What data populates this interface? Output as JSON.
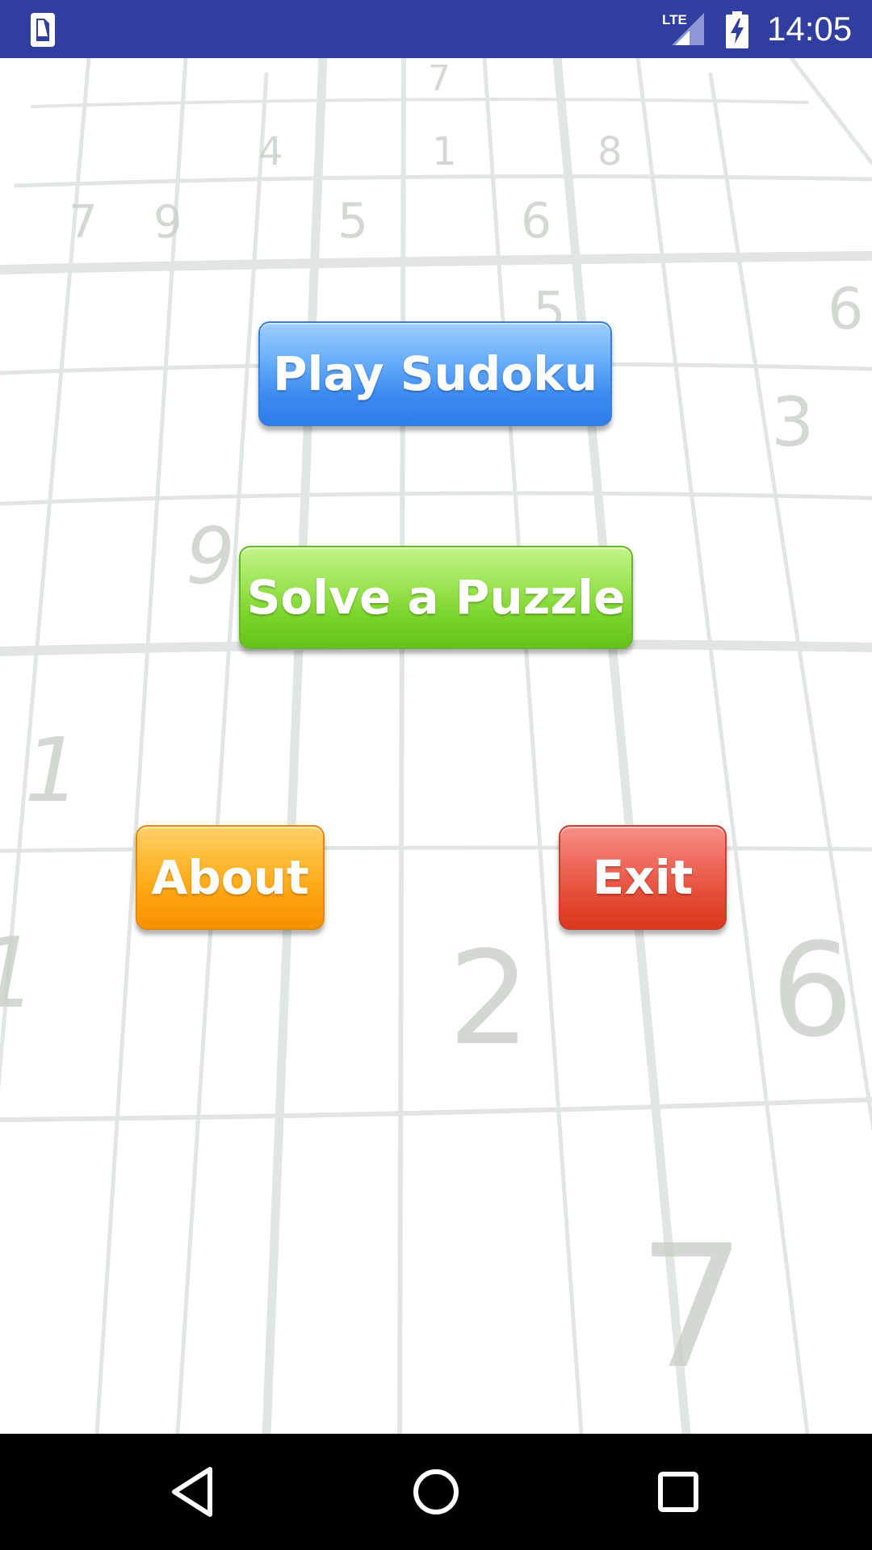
{
  "status_bar": {
    "network": "LTE",
    "time": "14:05",
    "icons": [
      "sim-card-icon",
      "lte-signal-icon",
      "battery-charging-icon"
    ]
  },
  "background": {
    "digits": [
      "7",
      "4",
      "1",
      "8",
      "7",
      "9",
      "5",
      "6",
      "5",
      "6",
      "3",
      "9",
      "1",
      "1",
      "2",
      "6",
      "7"
    ]
  },
  "menu": {
    "play_label": "Play Sudoku",
    "solve_label": "Solve a Puzzle",
    "about_label": "About",
    "exit_label": "Exit"
  },
  "colors": {
    "status_bar": "#303f9f",
    "play": "#3d8cf1",
    "solve": "#79d329",
    "about": "#ffa10e",
    "exit": "#e44a34",
    "nav_bar": "#000000"
  },
  "nav_bar": {
    "icons": [
      "back-triangle-icon",
      "home-circle-icon",
      "recents-square-icon"
    ]
  }
}
